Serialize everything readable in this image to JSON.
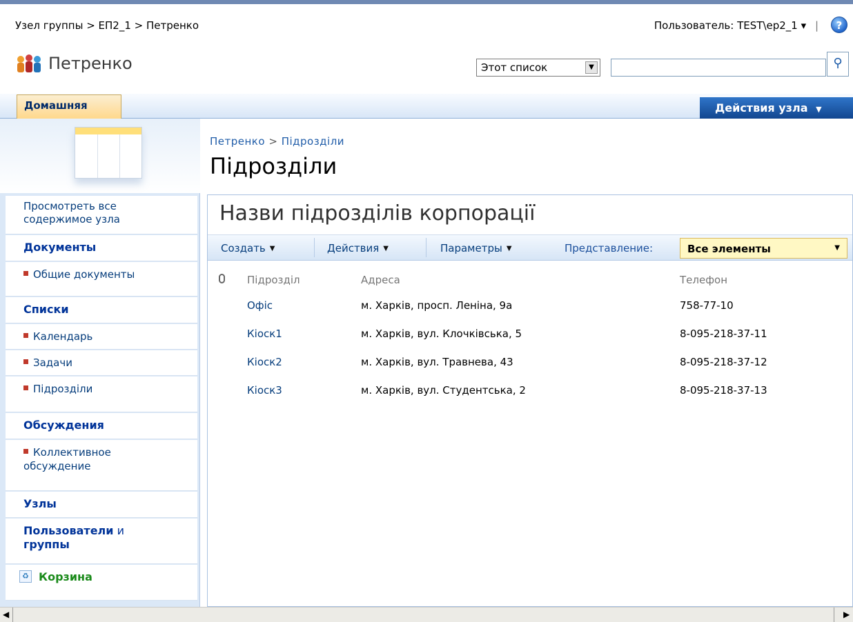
{
  "global_breadcrumb": "Узел группы > ЕП2_1 > Петренко",
  "user": {
    "label": "Пользователь:",
    "name": "TEST\\ep2_1",
    "dropdown_glyph": "▾",
    "separator": "|"
  },
  "help_icon": "?",
  "site": {
    "title": "Петренко",
    "logo_icon": "people-icon"
  },
  "search": {
    "scope": "Этот список",
    "value": "",
    "button_icon": "search-icon",
    "button_glyph": "⚲"
  },
  "nav": {
    "home_tab": "Домашняя",
    "site_actions": "Действия узла"
  },
  "page": {
    "breadcrumb_root": "Петренко",
    "breadcrumb_sep": ">",
    "breadcrumb_current": "Підрозділи",
    "title": "Підрозділи"
  },
  "quicklaunch": {
    "view_all": "Просмотреть все содержимое узла",
    "documents_header": "Документы",
    "documents_items": [
      "Общие документы"
    ],
    "lists_header": "Списки",
    "lists_items": [
      "Календарь",
      "Задачи",
      "Підрозділи"
    ],
    "discussions_header": "Обсуждения",
    "discussions_items": [
      "Коллективное обсуждение"
    ],
    "sites_header": "Узлы",
    "people_header_bold1": "Пользователи",
    "people_header_thin": " и",
    "people_header_bold2": "группы",
    "recycle": "Корзина"
  },
  "webpart": {
    "title": "Назви підрозділів корпорації",
    "toolbar": {
      "create": "Создать",
      "actions": "Действия",
      "settings": "Параметры",
      "view_label": "Представление:",
      "view_value": "Все элементы"
    },
    "columns": [
      "Підрозділ",
      "Адреса",
      "Телефон"
    ],
    "rows": [
      {
        "name": "Офіс",
        "address": "м. Харків, просп. Леніна, 9а",
        "phone": "758-77-10"
      },
      {
        "name": "Кіоск1",
        "address": "м. Харків, вул. Клочківська, 5",
        "phone": "8-095-218-37-11"
      },
      {
        "name": "Кіоск2",
        "address": "м. Харків, вул. Травнева, 43",
        "phone": "8-095-218-37-12"
      },
      {
        "name": "Кіоск3",
        "address": "м. Харків, вул. Студентська, 2",
        "phone": "8-095-218-37-13"
      }
    ]
  },
  "colors": {
    "link": "#063d7c",
    "accent": "#003399",
    "site_actions_bg": "#1a56a8",
    "tab_bg": "#ffd88c"
  }
}
